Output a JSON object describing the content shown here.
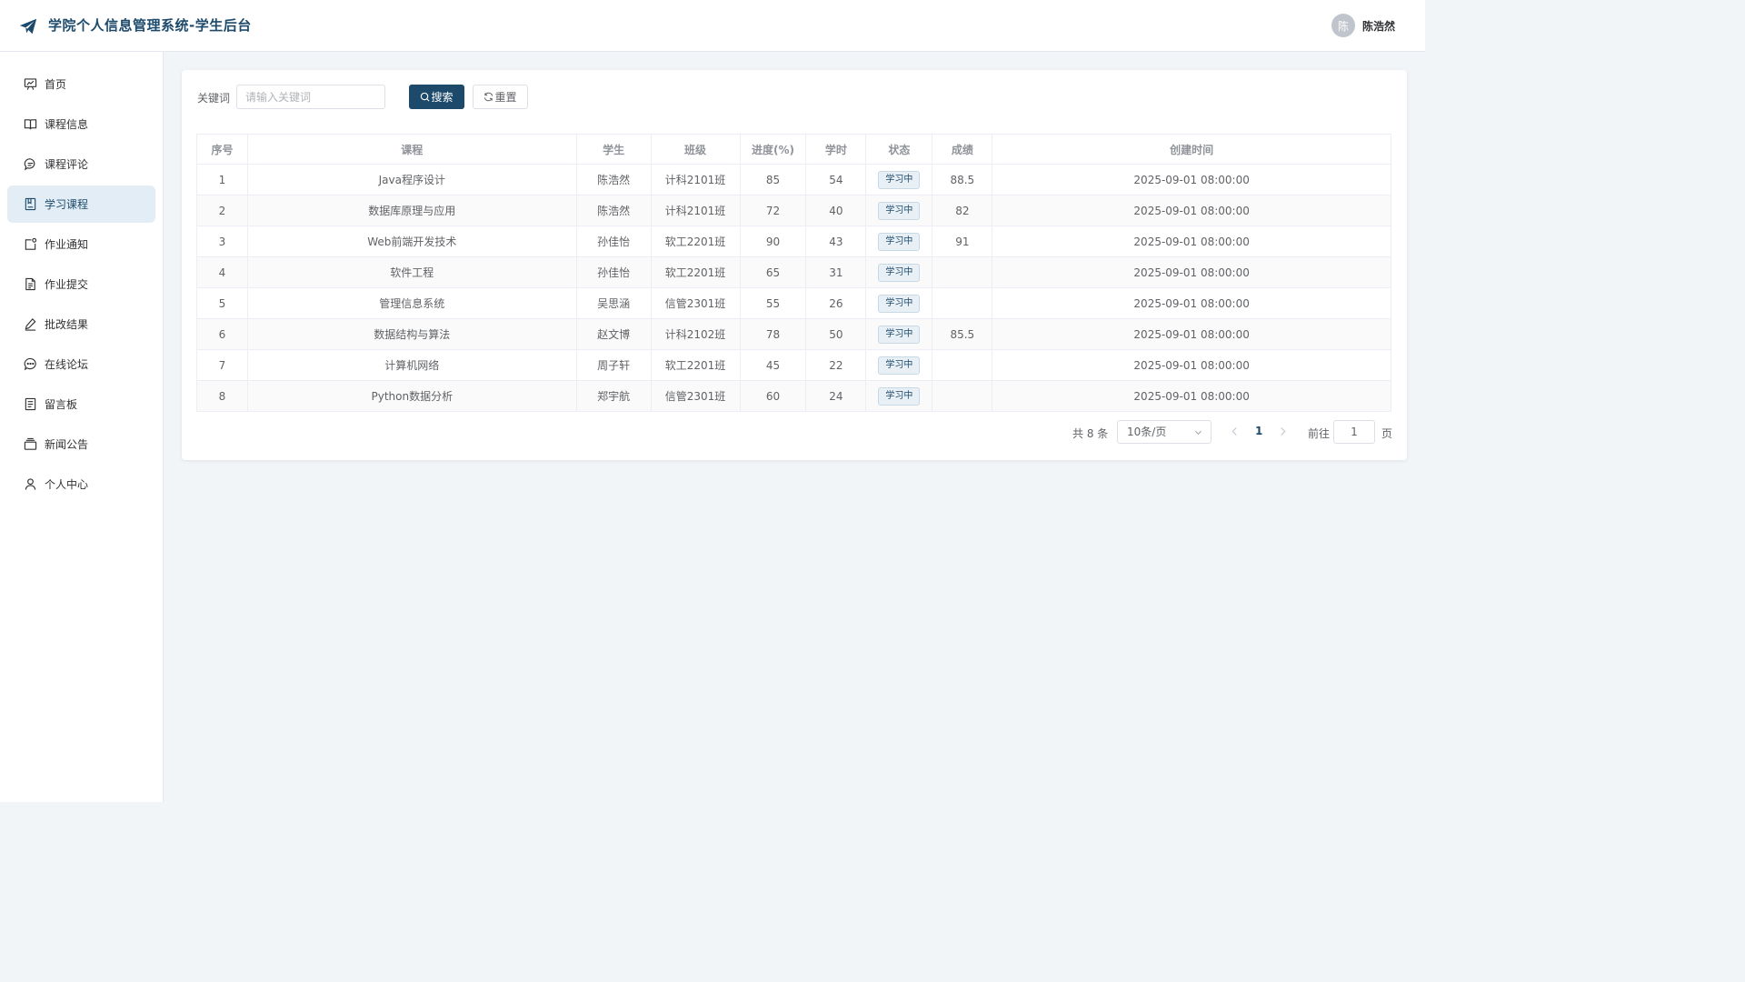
{
  "header": {
    "app_title": "学院个人信息管理系统-学生后台",
    "user_avatar_text": "陈",
    "user_name": "陈浩然"
  },
  "sidebar": {
    "items": [
      {
        "label": "首页",
        "icon": "dashboard-icon"
      },
      {
        "label": "课程信息",
        "icon": "book-icon"
      },
      {
        "label": "课程评论",
        "icon": "comment-icon"
      },
      {
        "label": "学习课程",
        "icon": "notebook-icon",
        "active": true
      },
      {
        "label": "作业通知",
        "icon": "notification-icon"
      },
      {
        "label": "作业提交",
        "icon": "document-icon"
      },
      {
        "label": "批改结果",
        "icon": "edit-pen-icon"
      },
      {
        "label": "在线论坛",
        "icon": "chat-dots-icon"
      },
      {
        "label": "留言板",
        "icon": "memo-icon"
      },
      {
        "label": "新闻公告",
        "icon": "news-icon"
      },
      {
        "label": "个人中心",
        "icon": "user-icon"
      }
    ]
  },
  "search": {
    "label": "关键词",
    "placeholder": "请输入关键词",
    "value": "",
    "search_label": "搜索",
    "reset_label": "重置"
  },
  "table": {
    "columns": [
      "序号",
      "课程",
      "学生",
      "班级",
      "进度(%)",
      "学时",
      "状态",
      "成绩",
      "创建时间"
    ],
    "rows": [
      [
        "1",
        "Java程序设计",
        "陈浩然",
        "计科2101班",
        "85",
        "54",
        "学习中",
        "88.5",
        "2025-09-01 08:00:00"
      ],
      [
        "2",
        "数据库原理与应用",
        "陈浩然",
        "计科2101班",
        "72",
        "40",
        "学习中",
        "82",
        "2025-09-01 08:00:00"
      ],
      [
        "3",
        "Web前端开发技术",
        "孙佳怡",
        "软工2201班",
        "90",
        "43",
        "学习中",
        "91",
        "2025-09-01 08:00:00"
      ],
      [
        "4",
        "软件工程",
        "孙佳怡",
        "软工2201班",
        "65",
        "31",
        "学习中",
        "",
        "2025-09-01 08:00:00"
      ],
      [
        "5",
        "管理信息系统",
        "吴思涵",
        "信管2301班",
        "55",
        "26",
        "学习中",
        "",
        "2025-09-01 08:00:00"
      ],
      [
        "6",
        "数据结构与算法",
        "赵文博",
        "计科2102班",
        "78",
        "50",
        "学习中",
        "85.5",
        "2025-09-01 08:00:00"
      ],
      [
        "7",
        "计算机网络",
        "周子轩",
        "软工2201班",
        "45",
        "22",
        "学习中",
        "",
        "2025-09-01 08:00:00"
      ],
      [
        "8",
        "Python数据分析",
        "郑宇航",
        "信管2301班",
        "60",
        "24",
        "学习中",
        "",
        "2025-09-01 08:00:00"
      ]
    ]
  },
  "pagination": {
    "total_text": "共 8 条",
    "page_size": "10条/页",
    "current_page": "1",
    "goto_label": "前往",
    "goto_value": "1",
    "page_unit": "页"
  },
  "colors": {
    "primary": "#1d4a6b",
    "active_bg": "#e3edf5",
    "page_bg": "#f2f5f8"
  }
}
